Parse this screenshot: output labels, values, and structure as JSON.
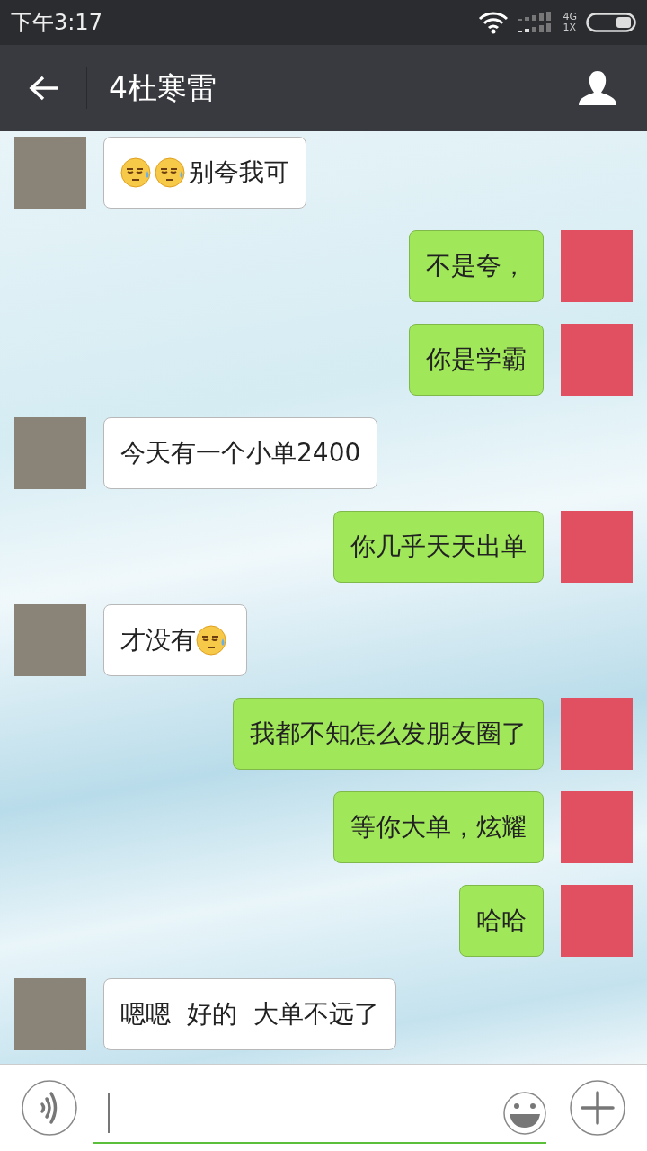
{
  "status_bar": {
    "time": "下午3:17",
    "network_top": "4G",
    "network_bottom": "1X"
  },
  "header": {
    "title": "4杜寒雷"
  },
  "messages": [
    {
      "outgoing": false,
      "segments": [
        {
          "kind": "emoji"
        },
        {
          "kind": "emoji"
        },
        {
          "kind": "text",
          "text": "别夸我可"
        }
      ]
    },
    {
      "outgoing": true,
      "segments": [
        {
          "kind": "text",
          "text": "不是夸，"
        }
      ]
    },
    {
      "outgoing": true,
      "segments": [
        {
          "kind": "text",
          "text": "你是学霸"
        }
      ]
    },
    {
      "outgoing": false,
      "segments": [
        {
          "kind": "text",
          "text": "今天有一个小单2400"
        }
      ]
    },
    {
      "outgoing": true,
      "segments": [
        {
          "kind": "text",
          "text": "你几乎天天出单"
        }
      ]
    },
    {
      "outgoing": false,
      "segments": [
        {
          "kind": "text",
          "text": "才没有"
        },
        {
          "kind": "emoji"
        }
      ]
    },
    {
      "outgoing": true,
      "segments": [
        {
          "kind": "text",
          "text": "我都不知怎么发朋友圈了"
        }
      ]
    },
    {
      "outgoing": true,
      "segments": [
        {
          "kind": "text",
          "text": "等你大单，炫耀"
        }
      ]
    },
    {
      "outgoing": true,
      "segments": [
        {
          "kind": "text",
          "text": "哈哈"
        }
      ]
    },
    {
      "outgoing": false,
      "segments": [
        {
          "kind": "text",
          "text": "嗯嗯  好的  大单不远了"
        }
      ]
    }
  ]
}
